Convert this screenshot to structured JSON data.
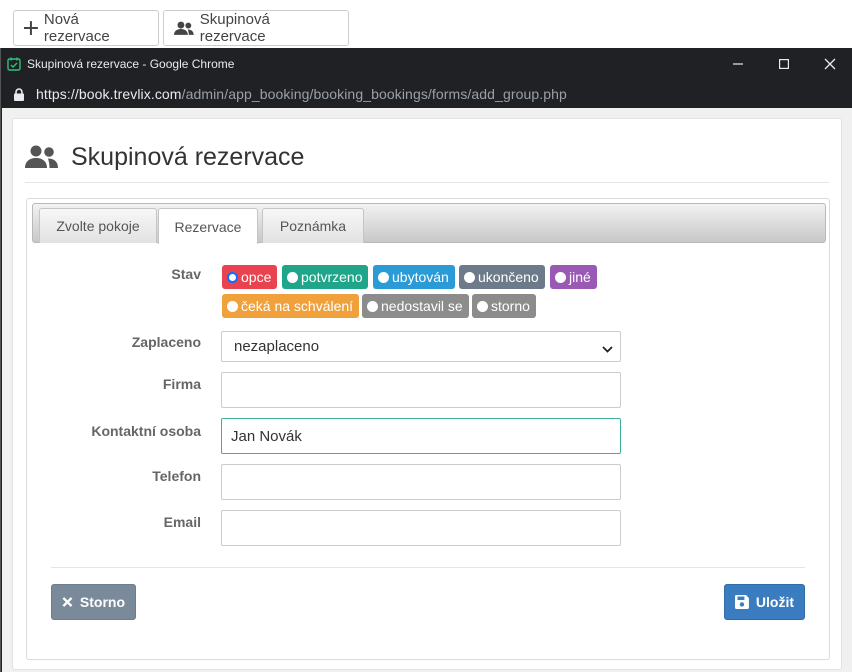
{
  "background_toolbar": {
    "new_reservation_label": "Nová rezervace",
    "group_reservation_label": "Skupinová rezervace"
  },
  "window": {
    "title": "Skupinová rezervace - Google Chrome",
    "url_scheme": "https://",
    "url_host": "book.trevlix.com",
    "url_path": "/admin/app_booking/booking_bookings/forms/add_group.php"
  },
  "dialog": {
    "title": "Skupinová rezervace",
    "tabs": [
      {
        "label": "Zvolte pokoje"
      },
      {
        "label": "Rezervace"
      },
      {
        "label": "Poznámka"
      }
    ],
    "active_tab": "Rezervace",
    "form": {
      "stav_label": "Stav",
      "stav_options": [
        {
          "label": "opce",
          "color": "#e8434f",
          "checked": true
        },
        {
          "label": "potvrzeno",
          "color": "#1fa58a",
          "checked": false
        },
        {
          "label": "ubytován",
          "color": "#2a9bd6",
          "checked": false
        },
        {
          "label": "ukončeno",
          "color": "#6c7a89",
          "checked": false
        },
        {
          "label": "jiné",
          "color": "#9b59b6",
          "checked": false
        },
        {
          "label": "čeká na schválení",
          "color": "#f0a13c",
          "checked": false
        },
        {
          "label": "nedostavil se",
          "color": "#8c8c8c",
          "checked": false
        },
        {
          "label": "storno",
          "color": "#8c8c8c",
          "checked": false
        }
      ],
      "zaplaceno_label": "Zaplaceno",
      "zaplaceno_value": "nezaplaceno",
      "firma_label": "Firma",
      "firma_value": "",
      "kontakt_label": "Kontaktní osoba",
      "kontakt_value": "Jan Novák",
      "telefon_label": "Telefon",
      "telefon_value": "",
      "email_label": "Email",
      "email_value": ""
    },
    "buttons": {
      "cancel_label": "Storno",
      "save_label": "Uložit"
    }
  }
}
